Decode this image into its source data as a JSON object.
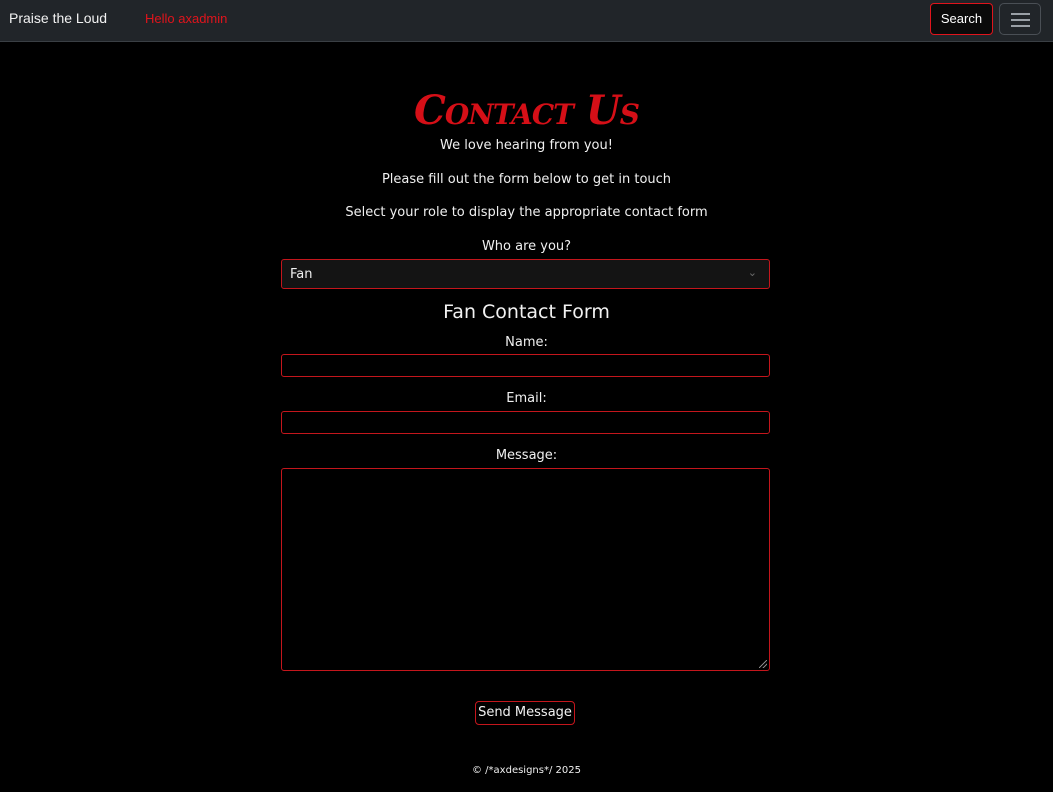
{
  "navbar": {
    "brand": "Praise the Loud",
    "greeting": "Hello axadmin",
    "search_label": "Search"
  },
  "page": {
    "title": "Contact Us",
    "subtitle": "We love hearing from you!",
    "instruction": "Please fill out the form below to get in touch",
    "role_hint": "Select your role to display the appropriate contact form",
    "role_label": "Who are you?",
    "role_selected": "Fan"
  },
  "form": {
    "title": "Fan Contact Form",
    "name_label": "Name:",
    "name_value": "",
    "email_label": "Email:",
    "email_value": "",
    "message_label": "Message:",
    "message_value": "",
    "submit_label": "Send Message"
  },
  "footer": {
    "text": "© /*axdesigns*/ 2025"
  },
  "colors": {
    "accent": "#d50f17",
    "navbar_bg": "#212529",
    "page_bg": "#000000"
  },
  "icons": {
    "menu": "hamburger-menu-icon",
    "select_arrow": "chevron-down-icon"
  }
}
